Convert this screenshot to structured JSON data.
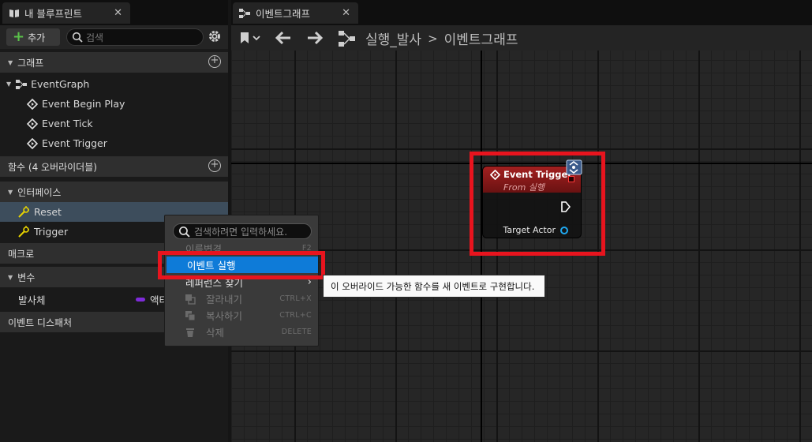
{
  "left_panel": {
    "tab_title": "내 블루프린트",
    "add_button": "추가",
    "search_placeholder": "검색",
    "sections": {
      "graphs": "그래프",
      "functions": "함수 (4 오버라이더블)",
      "interfaces": "인터페이스",
      "macros": "매크로",
      "variables": "변수",
      "event_dispatchers": "이벤트 디스패처"
    },
    "graph_items": {
      "event_graph": "EventGraph",
      "event_begin_play": "Event Begin Play",
      "event_tick": "Event Tick",
      "event_trigger": "Event Trigger"
    },
    "interface_items": {
      "reset": "Reset",
      "trigger": "Trigger"
    },
    "variable_items": {
      "name": "발사체",
      "type_partial": "액터"
    }
  },
  "graph_editor": {
    "tab_title": "이벤트그래프",
    "breadcrumb": {
      "root": "실행_발사",
      "current": "이벤트그래프"
    }
  },
  "node": {
    "title": "Event Trigger",
    "subtitle": "From 실행",
    "pin_label": "Target Actor"
  },
  "context_menu": {
    "search_placeholder": "검색하려면 입력하세요.",
    "items": {
      "rename": "이름변경",
      "rename_shortcut": "F2",
      "implement_event": "이벤트 실행",
      "find_references": "레퍼런스 찾기",
      "cut": "잘라내기",
      "cut_shortcut": "CTRL+X",
      "copy": "복사하기",
      "copy_shortcut": "CTRL+C",
      "delete": "삭제",
      "delete_shortcut": "DELETE"
    }
  },
  "tooltip": {
    "text": "이 오버라이드 가능한 함수를 새 이벤트로 구현합니다."
  },
  "colors": {
    "highlight_red": "#e8141e",
    "menu_selected_blue": "#0e7bd8",
    "event_node_red": "#a32020",
    "object_pin_blue": "#1fa8f0"
  }
}
